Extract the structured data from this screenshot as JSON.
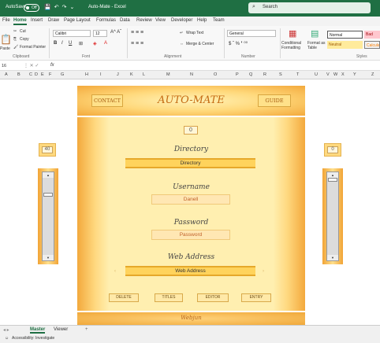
{
  "titlebar": {
    "autosave_label": "AutoSave",
    "autosave_state": "Off",
    "title": "Auto-Mate - Excel",
    "search_placeholder": "Search"
  },
  "ribbon_tabs": [
    "File",
    "Home",
    "Insert",
    "Draw",
    "Page Layout",
    "Formulas",
    "Data",
    "Review",
    "View",
    "Developer",
    "Help",
    "Team"
  ],
  "ribbon": {
    "clipboard": {
      "paste": "Paste",
      "cut": "Cut",
      "copy": "Copy",
      "format_painter": "Format Painter",
      "group": "Clipboard"
    },
    "font": {
      "name": "Calibri",
      "size": "12",
      "group": "Font"
    },
    "alignment": {
      "wrap_text": "Wrap Text",
      "merge_center": "Merge & Center",
      "group": "Alignment"
    },
    "number": {
      "format": "General",
      "group": "Number"
    },
    "styles": {
      "conditional": "Conditional Formatting",
      "format_table": "Format as Table",
      "normal": "Normal",
      "bad": "Bad",
      "neutral": "Neutral",
      "calculation": "Calculatio",
      "group": "Styles"
    }
  },
  "formula_bar": {
    "name_box": "16",
    "fx": "fx",
    "value": ""
  },
  "columns": [
    "A",
    "B",
    "C",
    "D",
    "E",
    "F",
    "G",
    "H",
    "I",
    "J",
    "K",
    "L",
    "M",
    "N",
    "O",
    "P",
    "Q",
    "R",
    "S",
    "T",
    "U",
    "V",
    "W",
    "X",
    "Y",
    "Z"
  ],
  "form": {
    "title": "AUTO-MATE",
    "contact_button": "CONTACT",
    "guide_button": "GUIDE",
    "counter": "0",
    "directory_label": "Directory",
    "directory_value": "Directory",
    "username_label": "Username",
    "username_value": "Danell",
    "password_label": "Password",
    "password_value": "Password",
    "web_label": "Web Address",
    "web_value": "Web Address",
    "prev_arrow": "‹",
    "next_arrow": "›",
    "buttons": [
      "DELETE",
      "TITLES",
      "EDITOR",
      "ENTRY"
    ],
    "footer": "Webjun",
    "left_counter": "40",
    "right_counter": "0",
    "left_scroll_position": 0.2,
    "right_scroll_position": 0.0
  },
  "sheet_tabs": [
    "Master",
    "Viewer"
  ],
  "status": {
    "accessibility": "Accessibility: Investigate"
  },
  "colors": {
    "excel_green": "#1f6f43",
    "gold": "#ffd35c",
    "orange": "#f3a93c",
    "title_orange": "#c46a12"
  }
}
